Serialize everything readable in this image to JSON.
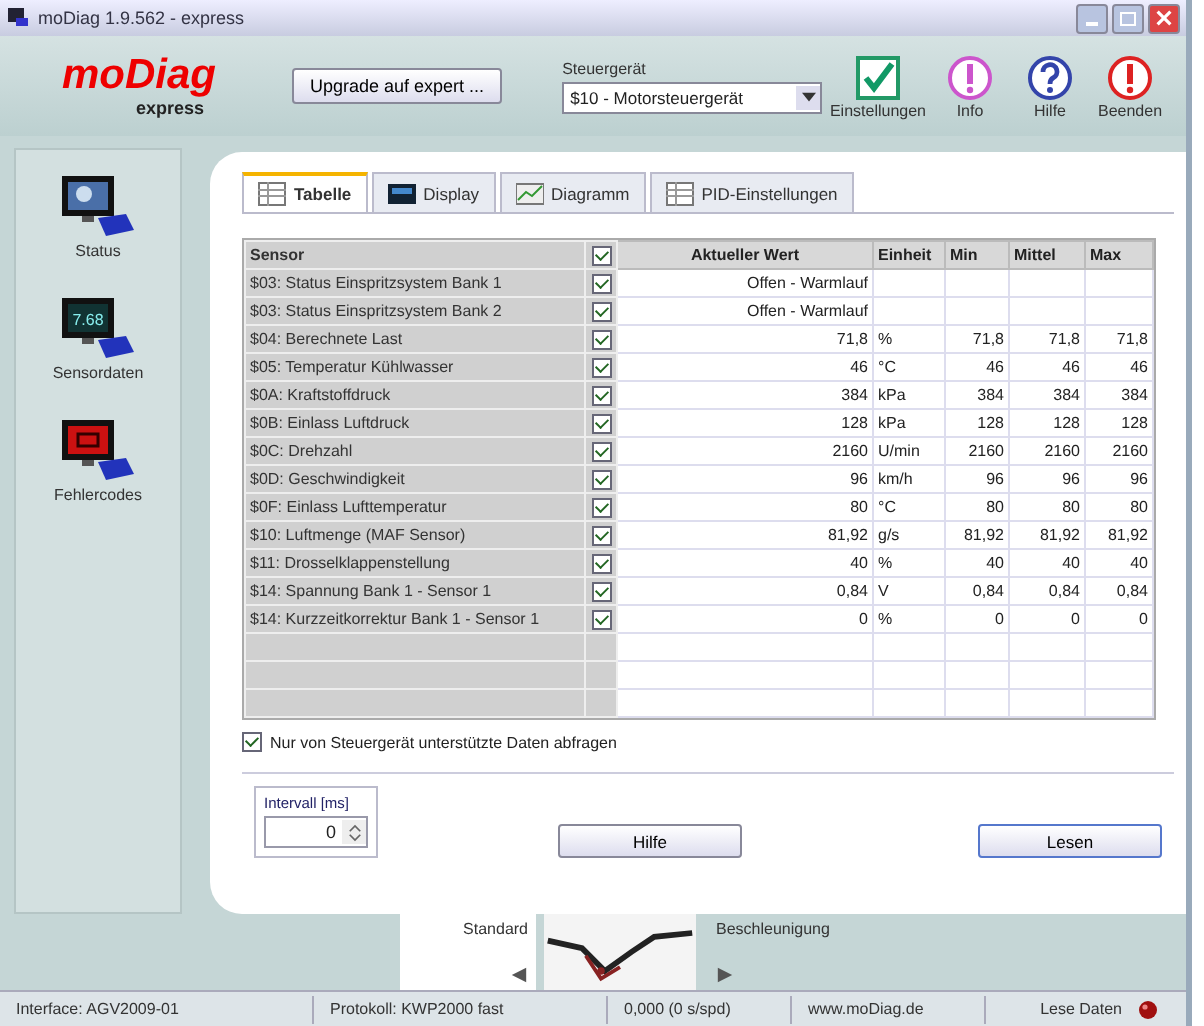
{
  "window": {
    "title": "moDiag 1.9.562 - express"
  },
  "logo": {
    "name": "moDiag",
    "edition": "express"
  },
  "upgrade_button": "Upgrade auf expert ...",
  "ecu": {
    "label": "Steuergerät",
    "value": "$10 - Motorsteuergerät"
  },
  "toolbar": [
    {
      "kind": "check",
      "label": "Einstellungen"
    },
    {
      "kind": "info",
      "label": "Info"
    },
    {
      "kind": "help",
      "label": "Hilfe"
    },
    {
      "kind": "exit",
      "label": "Beenden"
    }
  ],
  "sidebar": {
    "items": [
      {
        "kind": "status",
        "label": "Status"
      },
      {
        "kind": "sensor",
        "label": "Sensordaten",
        "screen": "7.68"
      },
      {
        "kind": "fault",
        "label": "Fehlercodes"
      }
    ]
  },
  "tabs": [
    {
      "kind": "table",
      "label": "Tabelle",
      "selected": true
    },
    {
      "kind": "display",
      "label": "Display",
      "selected": false
    },
    {
      "kind": "chart",
      "label": "Diagramm",
      "selected": false
    },
    {
      "kind": "pid",
      "label": "PID-Einstellungen",
      "selected": false
    }
  ],
  "table": {
    "columns": [
      "Sensor",
      "Aktueller Wert",
      "Einheit",
      "Min",
      "Mittel",
      "Max"
    ],
    "header_checked": true,
    "rows": [
      {
        "sensor": "$03: Status Einspritzsystem Bank 1",
        "checked": true,
        "value": "Offen - Warmlauf",
        "unit": "",
        "min": "",
        "mean": "",
        "max": ""
      },
      {
        "sensor": "$03: Status Einspritzsystem Bank 2",
        "checked": true,
        "value": "Offen - Warmlauf",
        "unit": "",
        "min": "",
        "mean": "",
        "max": ""
      },
      {
        "sensor": "$04: Berechnete Last",
        "checked": true,
        "value": "71,8",
        "unit": "%",
        "min": "71,8",
        "mean": "71,8",
        "max": "71,8"
      },
      {
        "sensor": "$05: Temperatur Kühlwasser",
        "checked": true,
        "value": "46",
        "unit": "°C",
        "min": "46",
        "mean": "46",
        "max": "46"
      },
      {
        "sensor": "$0A: Kraftstoffdruck",
        "checked": true,
        "value": "384",
        "unit": "kPa",
        "min": "384",
        "mean": "384",
        "max": "384"
      },
      {
        "sensor": "$0B: Einlass Luftdruck",
        "checked": true,
        "value": "128",
        "unit": "kPa",
        "min": "128",
        "mean": "128",
        "max": "128"
      },
      {
        "sensor": "$0C: Drehzahl",
        "checked": true,
        "value": "2160",
        "unit": "U/min",
        "min": "2160",
        "mean": "2160",
        "max": "2160"
      },
      {
        "sensor": "$0D: Geschwindigkeit",
        "checked": true,
        "value": "96",
        "unit": "km/h",
        "min": "96",
        "mean": "96",
        "max": "96"
      },
      {
        "sensor": "$0F: Einlass Lufttemperatur",
        "checked": true,
        "value": "80",
        "unit": "°C",
        "min": "80",
        "mean": "80",
        "max": "80"
      },
      {
        "sensor": "$10: Luftmenge (MAF Sensor)",
        "checked": true,
        "value": "81,92",
        "unit": "g/s",
        "min": "81,92",
        "mean": "81,92",
        "max": "81,92"
      },
      {
        "sensor": "$11: Drosselklappenstellung",
        "checked": true,
        "value": "40",
        "unit": "%",
        "min": "40",
        "mean": "40",
        "max": "40"
      },
      {
        "sensor": "$14: Spannung Bank 1 - Sensor 1",
        "checked": true,
        "value": "0,84",
        "unit": "V",
        "min": "0,84",
        "mean": "0,84",
        "max": "0,84"
      },
      {
        "sensor": "$14: Kurzzeitkorrektur Bank 1 - Sensor 1",
        "checked": true,
        "value": "0",
        "unit": "%",
        "min": "0",
        "mean": "0",
        "max": "0"
      }
    ]
  },
  "only_supported": {
    "label": "Nur von Steuergerät unterstützte Daten abfragen",
    "checked": true
  },
  "interval": {
    "label": "Intervall [ms]",
    "value": "0"
  },
  "buttons": [
    "Hilfe",
    "Lesen"
  ],
  "carousel": {
    "previous": "Standard",
    "next": "Beschleunigung"
  },
  "status_bar": [
    "Interface: AGV2009-01",
    "Protokoll: KWP2000 fast",
    "0,000 (0 s/spd)",
    "www.moDiag.de",
    "Lese Daten"
  ]
}
